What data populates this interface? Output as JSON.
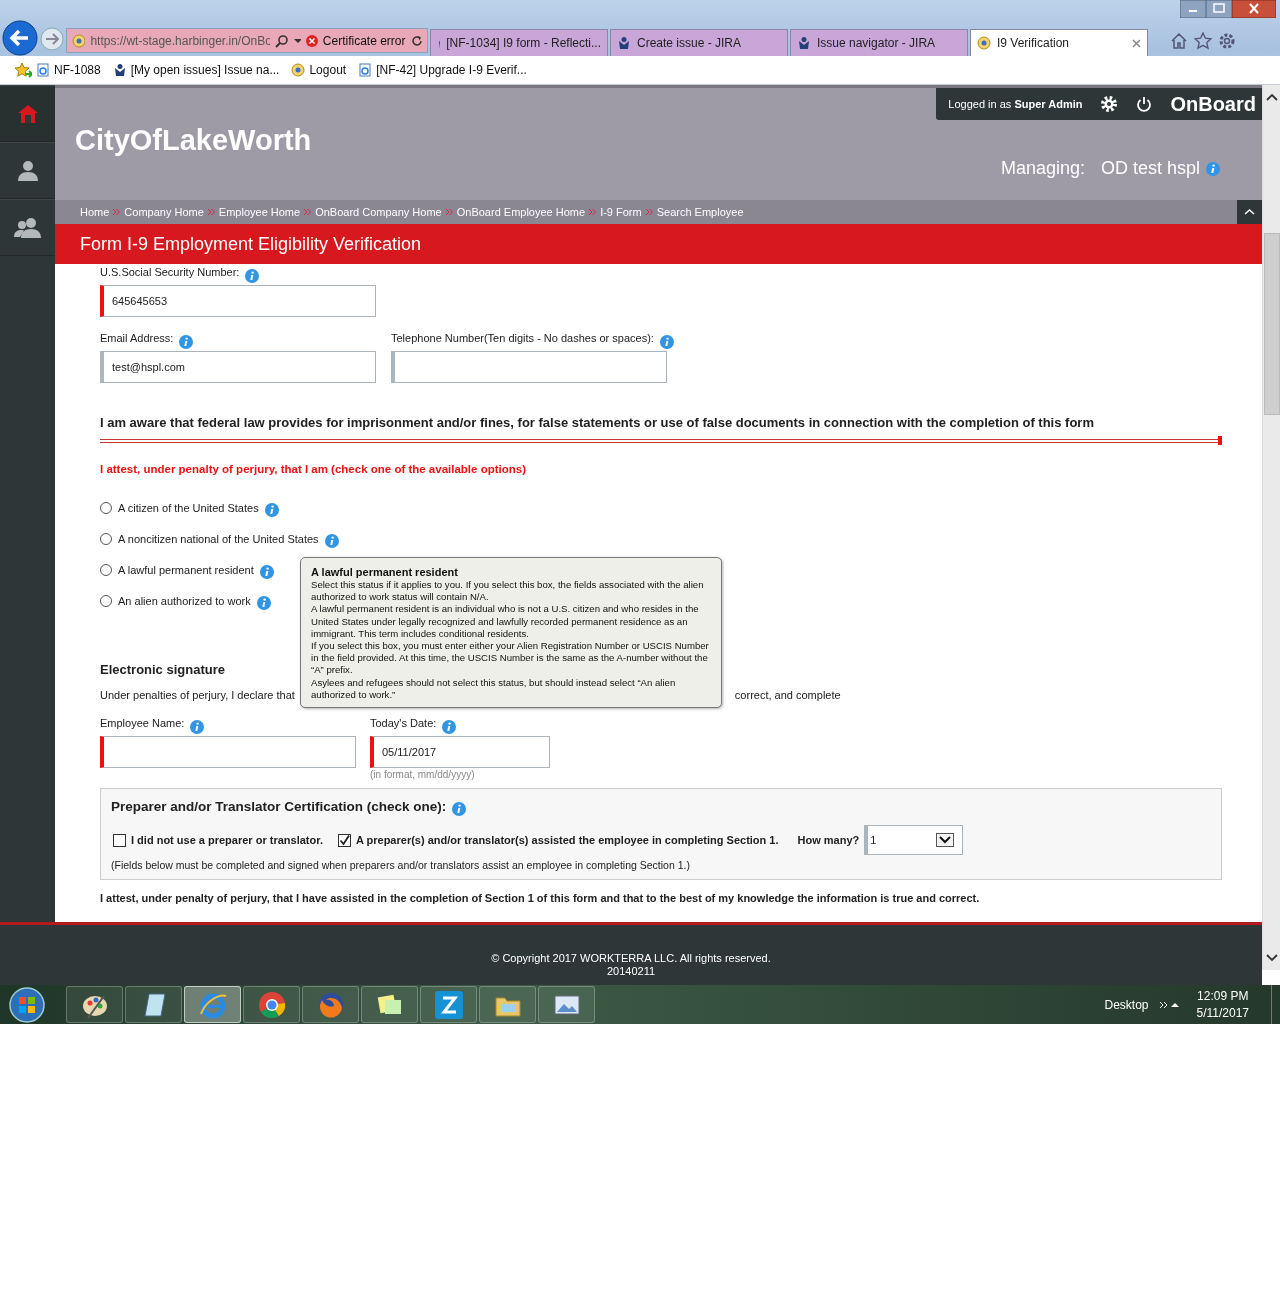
{
  "browser": {
    "address": "https://wt-stage.harbinger.in/OnBo",
    "cert_error": "Certificate error",
    "tabs": [
      {
        "label": "[NF-1034] I9 form - Reflecti...",
        "kind": "jira",
        "selected": false
      },
      {
        "label": "Create issue - JIRA",
        "kind": "jira",
        "selected": false
      },
      {
        "label": "Issue navigator - JIRA",
        "kind": "jira",
        "selected": false
      },
      {
        "label": "I9 Verification",
        "kind": "site",
        "selected": true
      }
    ],
    "favorites": [
      {
        "label": "NF-1088",
        "kind": "page"
      },
      {
        "label": "[My open issues] Issue na...",
        "kind": "jira"
      },
      {
        "label": "Logout",
        "kind": "site"
      },
      {
        "label": "[NF-42] Upgrade I-9 Everif...",
        "kind": "page"
      }
    ]
  },
  "sidebar": {
    "items": [
      {
        "kind": "home",
        "selected": true
      },
      {
        "kind": "user",
        "selected": false
      },
      {
        "kind": "users",
        "selected": false
      }
    ]
  },
  "header": {
    "logged_in_prefix": "Logged in as",
    "user": "Super Admin",
    "app_name": "OnBoard",
    "company": "CityOfLakeWorth",
    "managing_label": "Managing:",
    "managing_value": "OD test hspl"
  },
  "breadcrumbs": [
    "Home",
    "Company Home",
    "Employee Home",
    "OnBoard Company Home",
    "OnBoard Employee Home",
    "I-9 Form",
    "Search Employee"
  ],
  "page_title": "Form I-9 Employment Eligibility Verification",
  "form": {
    "ssn": {
      "label": "U.S.Social Security Number:",
      "value": "645645653",
      "required": true
    },
    "email": {
      "label": "Email Address:",
      "value": "test@hspl.com",
      "required": false
    },
    "phone": {
      "label": "Telephone Number(Ten digits - No dashes or spaces):",
      "required": false
    },
    "warning": "I am aware that federal law provides for imprisonment and/or fines, for false statements or use of false documents in connection with the completion of this form",
    "attest": "I attest, under penalty of perjury, that I am (check one of the available options)",
    "statuses": [
      {
        "label": "A citizen of the United States",
        "selected": false
      },
      {
        "label": "A noncitizen national of the United States",
        "selected": false
      },
      {
        "label": "A lawful permanent resident",
        "selected": false
      },
      {
        "label": "An alien authorized to work",
        "selected": false
      }
    ],
    "signature_heading": "Electronic signature",
    "signature_text_start": "Under penalties of perjury, I declare that",
    "signature_text_end": "correct, and complete",
    "employee_name": {
      "label": "Employee Name:",
      "required": true
    },
    "date": {
      "label": "Today's Date:",
      "value": "05/11/2017",
      "required": true,
      "hint": "(in format, mm/dd/yyyy)"
    }
  },
  "tooltip": {
    "title": "A lawful permanent resident",
    "paragraphs": [
      "Select this status if it applies to you. If you select this box, the fields associated with the alien authorized to work status will contain N/A.",
      "A lawful permanent resident is an individual who is not a U.S. citizen and who resides in the United States under legally recognized and lawfully recorded permanent residence as an immigrant. This term includes conditional residents.",
      "If you select this box, you must enter either your Alien Registration Number or USCIS Number in the field provided. At this time, the USCIS Number is the same as the A-number without the “A” prefix.",
      "Asylees and refugees should not select this status, but should instead select “An alien authorized to work.”"
    ]
  },
  "preparer": {
    "title": "Preparer and/or Translator Certification (check one):",
    "options": [
      {
        "label": "I did not use a preparer or translator.",
        "checked": false
      },
      {
        "label": "A preparer(s) and/or translator(s) assisted the employee in completing Section 1.",
        "checked": true
      }
    ],
    "how_many_label": "How many?",
    "how_many_value": "1",
    "note": "(Fields below must be completed and signed when preparers and/or translators assist an employee in completing Section 1.)"
  },
  "final_attest": "I attest, under penalty of perjury, that I have assisted in the completion of Section 1 of this form and that to the best of my knowledge the information is true and correct.",
  "footer": {
    "copyright": "© Copyright 2017 WORKTERRA LLC. All rights reserved.",
    "build": "20140211"
  },
  "taskbar": {
    "apps": [
      {
        "kind": "paint",
        "selected": false
      },
      {
        "kind": "notepad",
        "selected": false
      },
      {
        "kind": "ie",
        "selected": true
      },
      {
        "kind": "chrome",
        "selected": false
      },
      {
        "kind": "firefox",
        "selected": false
      },
      {
        "kind": "notes",
        "selected": false
      },
      {
        "kind": "z",
        "selected": false
      },
      {
        "kind": "folder",
        "selected": false
      },
      {
        "kind": "picture",
        "selected": false
      }
    ],
    "desktop": "Desktop",
    "time": "12:09 PM",
    "date": "5/11/2017"
  }
}
